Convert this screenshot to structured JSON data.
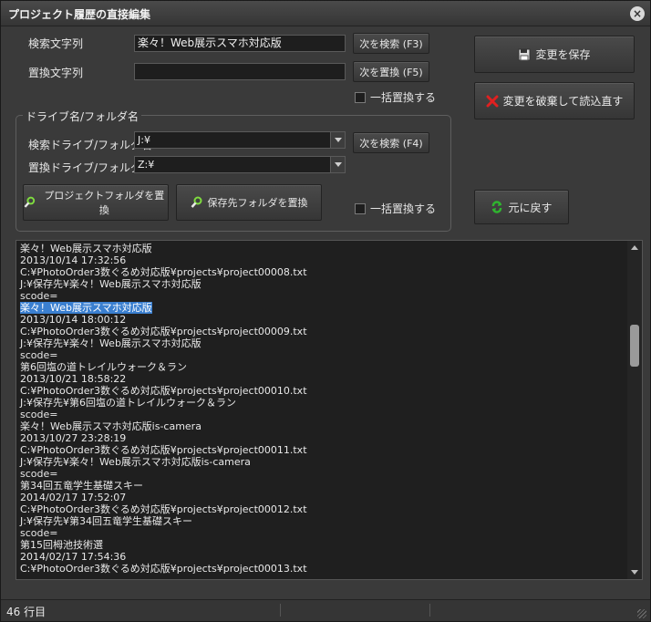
{
  "window": {
    "title": "プロジェクト履歴の直接編集"
  },
  "search": {
    "label": "検索文字列",
    "value": "楽々！Web展示スマホ対応版",
    "find_button": "次を検索 (F3)"
  },
  "replace": {
    "label": "置換文字列",
    "value": "",
    "replace_button": "次を置換 (F5)",
    "replace_all_label": "一括置換する"
  },
  "actions": {
    "save_label": "変更を保存",
    "discard_label": "変更を破棄して読込直す",
    "undo_label": "元に戻す"
  },
  "drive": {
    "group_label": "ドライブ名/フォルダ名",
    "search_label": "検索ドライブ/フォルダ名",
    "search_value": "J:¥",
    "find_button": "次を検索 (F4)",
    "replace_label": "置換ドライブ/フォルダ名",
    "replace_value": "Z:¥",
    "project_button": "プロジェクトフォルダを置換",
    "save_dest_button": "保存先フォルダを置換",
    "replace_all_label": "一括置換する"
  },
  "editor": {
    "lines": [
      "楽々！Web展示スマホ対応版",
      "2013/10/14 17:32:56",
      "C:¥PhotoOrder3数ぐるめ対応版¥projects¥project00008.txt",
      "J:¥保存先¥楽々！Web展示スマホ対応版",
      "scode=",
      "楽々！Web展示スマホ対応版",
      "2013/10/14 18:00:12",
      "C:¥PhotoOrder3数ぐるめ対応版¥projects¥project00009.txt",
      "J:¥保存先¥楽々！Web展示スマホ対応版",
      "scode=",
      "第6回塩の道トレイルウォーク＆ラン",
      "2013/10/21 18:58:22",
      "C:¥PhotoOrder3数ぐるめ対応版¥projects¥project00010.txt",
      "J:¥保存先¥第6回塩の道トレイルウォーク＆ラン",
      "scode=",
      "楽々！Web展示スマホ対応版is-camera",
      "2013/10/27 23:28:19",
      "C:¥PhotoOrder3数ぐるめ対応版¥projects¥project00011.txt",
      "J:¥保存先¥楽々！Web展示スマホ対応版is-camera",
      "scode=",
      "第34回五竜学生基礎スキー",
      "2014/02/17 17:52:07",
      "C:¥PhotoOrder3数ぐるめ対応版¥projects¥project00012.txt",
      "J:¥保存先¥第34回五竜学生基礎スキー",
      "scode=",
      "第15回栂池技術選",
      "2014/02/17 17:54:36",
      "C:¥PhotoOrder3数ぐるめ対応版¥projects¥project00013.txt"
    ],
    "selected_line": 5
  },
  "status": {
    "line_count": "46 行目"
  },
  "colors": {
    "selection": "#3a7fd0",
    "window_bg": "#3a3a3a",
    "editor_bg": "#1f1f1f"
  }
}
